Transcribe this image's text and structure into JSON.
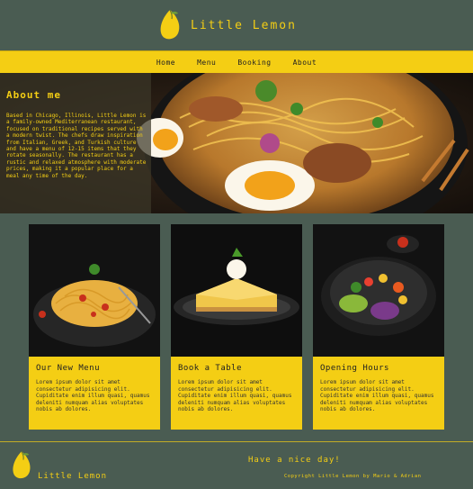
{
  "brand": {
    "name": "Little Lemon"
  },
  "nav": [
    "Home",
    "Menu",
    "Booking",
    "About"
  ],
  "about": {
    "title": "About me",
    "text": "Based in Chicago, Illinois, Little Lemon is a family-owned Mediterranean restaurant, focused on traditional recipes served with a modern twist. The chefs draw inspiration from Italian, Greek, and Turkish culture and have a menu of 12-15 items that they rotate seasonally. The restaurant has a rustic and relaxed atmosphere with moderate prices, making it a popular place for a meal any time of the day."
  },
  "cards": [
    {
      "title": "Our New Menu",
      "text": "Lorem ipsum dolor sit amet consectetur adipisicing elit. Cupiditate enim illum quasi, quamus deleniti numquam alias voluptates nobis ab dolores."
    },
    {
      "title": "Book a Table",
      "text": "Lorem ipsum dolor sit amet consectetur adipisicing elit. Cupiditate enim illum quasi, quamus deleniti numquam alias voluptates nobis ab dolores."
    },
    {
      "title": "Opening Hours",
      "text": "Lorem ipsum dolor sit amet consectetur adipisicing elit. Cupiditate enim illum quasi, quamus deleniti numquam alias voluptates nobis ab dolores."
    }
  ],
  "footer": {
    "brand": "Little Lemon",
    "tagline": "Have a nice day!",
    "copyright": "Copyright Little Lemon by Mario & Adrian"
  },
  "colors": {
    "accent": "#f4ce14",
    "background": "#4a5c52"
  },
  "icons": [
    "lemon-logo-icon"
  ]
}
